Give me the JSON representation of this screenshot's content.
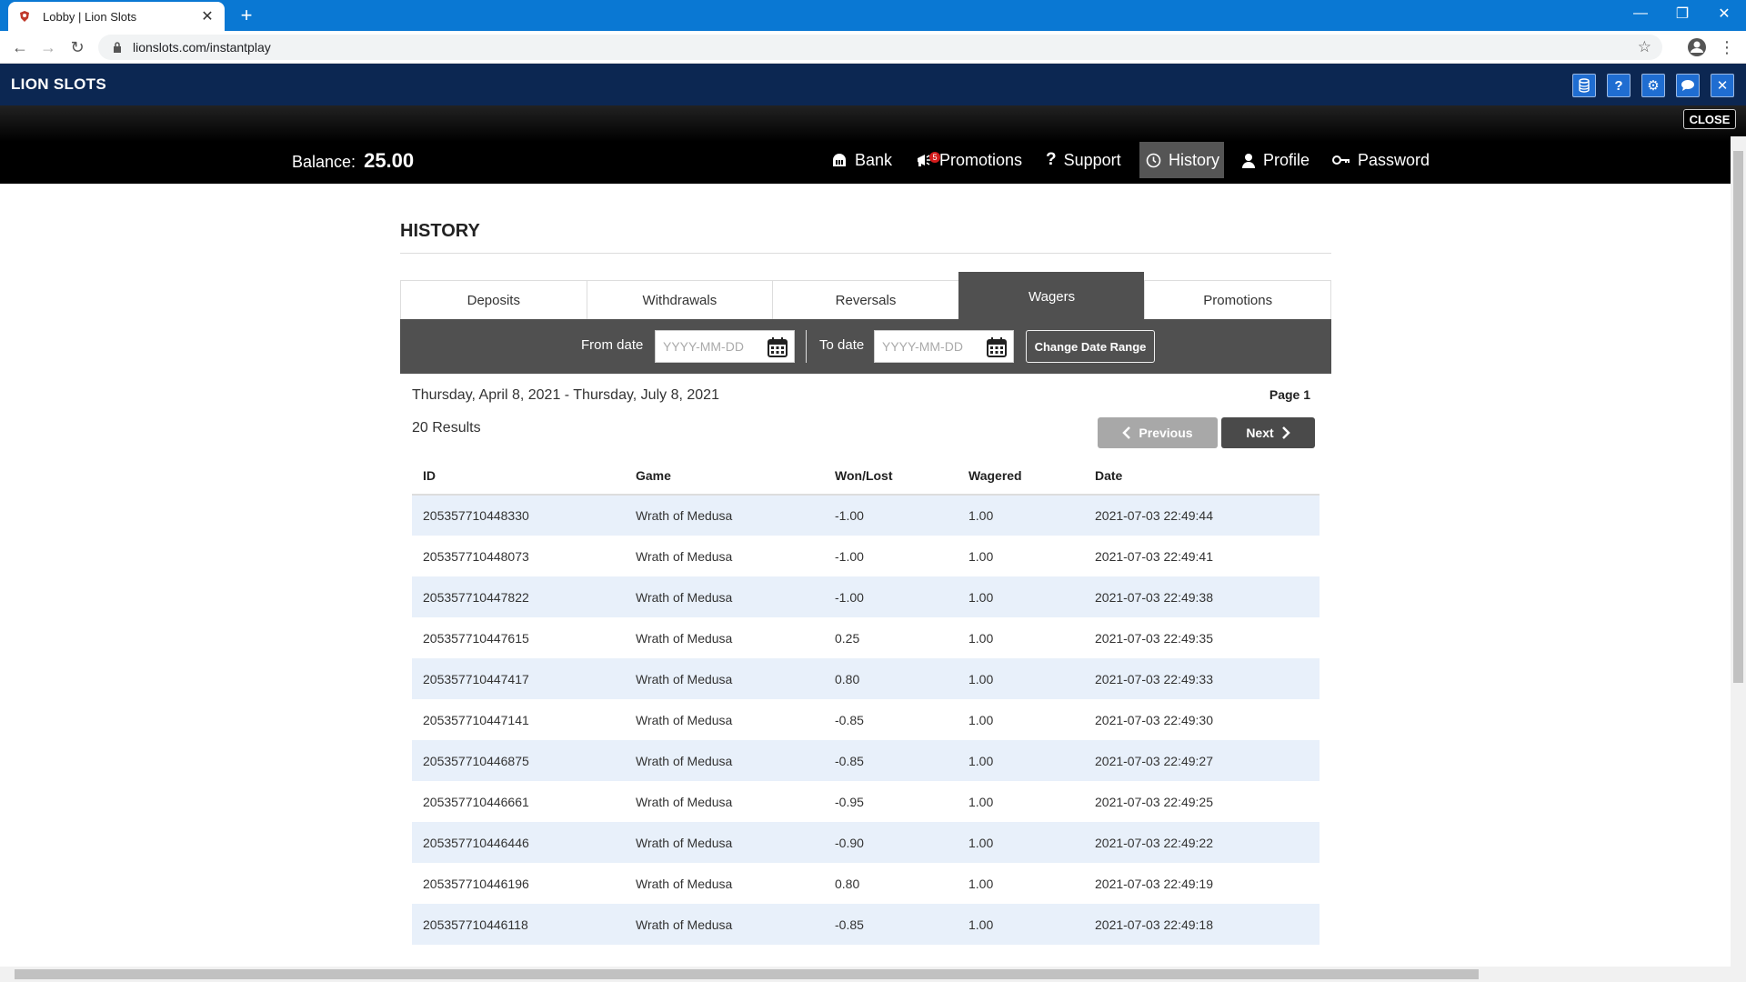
{
  "browser": {
    "tab_title": "Lobby | Lion Slots",
    "url": "lionslots.com/instantplay"
  },
  "site": {
    "logo": "LION SLOTS",
    "close_label": "CLOSE",
    "balance_label": "Balance:",
    "balance_value": "25.00",
    "header_icons": [
      "coins-icon",
      "help-icon",
      "gear-icon",
      "chat-icon",
      "close-icon"
    ],
    "nav": [
      {
        "label": "Bank",
        "icon": "bank-icon"
      },
      {
        "label": "Promotions",
        "icon": "megaphone-icon",
        "badge": "5"
      },
      {
        "label": "Support",
        "icon": "question-icon"
      },
      {
        "label": "History",
        "icon": "clock-icon",
        "active": true
      },
      {
        "label": "Profile",
        "icon": "user-icon"
      },
      {
        "label": "Password",
        "icon": "key-icon"
      }
    ]
  },
  "history": {
    "title": "HISTORY",
    "tabs": [
      "Deposits",
      "Withdrawals",
      "Reversals",
      "Wagers",
      "Promotions"
    ],
    "active_tab": "Wagers",
    "from_label": "From date",
    "to_label": "To date",
    "date_placeholder": "YYYY-MM-DD",
    "change_range_label": "Change Date Range",
    "range_text": "Thursday, April 8, 2021 - Thursday, July 8, 2021",
    "page_label": "Page 1",
    "results_label": "20 Results",
    "prev_label": "Previous",
    "next_label": "Next",
    "columns": [
      "ID",
      "Game",
      "Won/Lost",
      "Wagered",
      "Date"
    ],
    "rows": [
      [
        "205357710448330",
        "Wrath of Medusa",
        "-1.00",
        "1.00",
        "2021-07-03 22:49:44"
      ],
      [
        "205357710448073",
        "Wrath of Medusa",
        "-1.00",
        "1.00",
        "2021-07-03 22:49:41"
      ],
      [
        "205357710447822",
        "Wrath of Medusa",
        "-1.00",
        "1.00",
        "2021-07-03 22:49:38"
      ],
      [
        "205357710447615",
        "Wrath of Medusa",
        "0.25",
        "1.00",
        "2021-07-03 22:49:35"
      ],
      [
        "205357710447417",
        "Wrath of Medusa",
        "0.80",
        "1.00",
        "2021-07-03 22:49:33"
      ],
      [
        "205357710447141",
        "Wrath of Medusa",
        "-0.85",
        "1.00",
        "2021-07-03 22:49:30"
      ],
      [
        "205357710446875",
        "Wrath of Medusa",
        "-0.85",
        "1.00",
        "2021-07-03 22:49:27"
      ],
      [
        "205357710446661",
        "Wrath of Medusa",
        "-0.95",
        "1.00",
        "2021-07-03 22:49:25"
      ],
      [
        "205357710446446",
        "Wrath of Medusa",
        "-0.90",
        "1.00",
        "2021-07-03 22:49:22"
      ],
      [
        "205357710446196",
        "Wrath of Medusa",
        "0.80",
        "1.00",
        "2021-07-03 22:49:19"
      ],
      [
        "205357710446118",
        "Wrath of Medusa",
        "-0.85",
        "1.00",
        "2021-07-03 22:49:18"
      ]
    ]
  }
}
